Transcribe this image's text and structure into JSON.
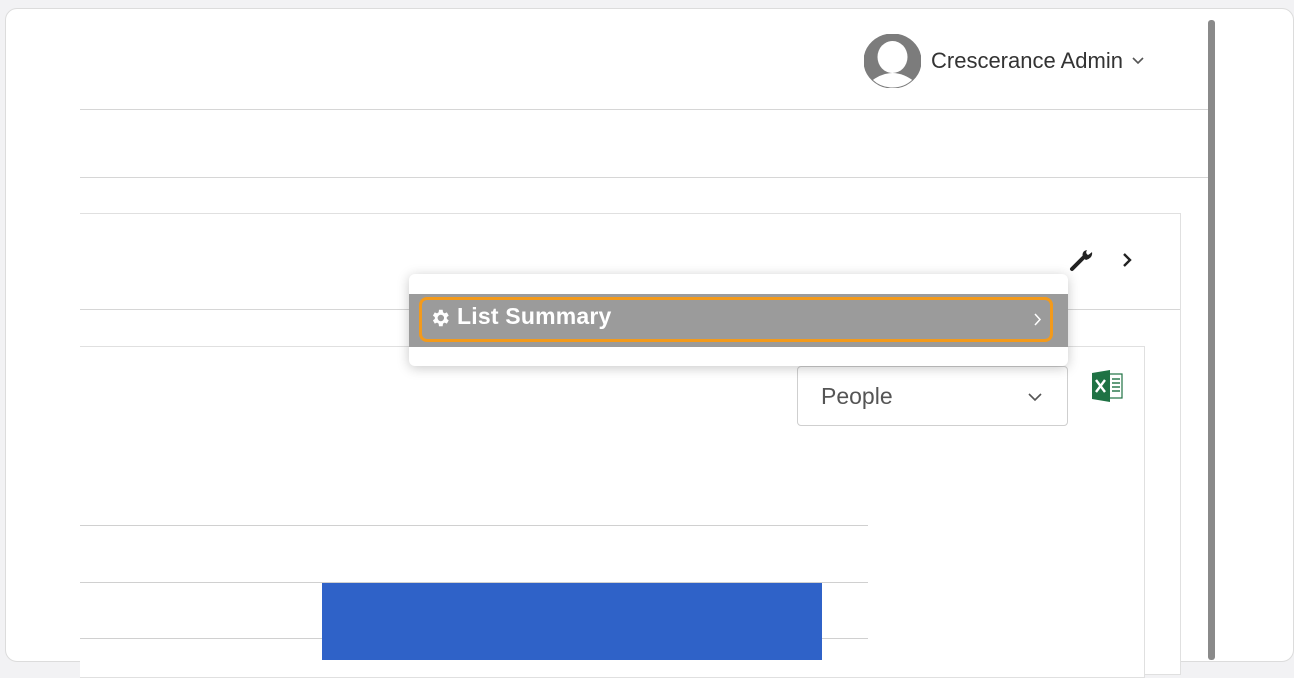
{
  "header": {
    "user_name": "Crescerance Admin",
    "user_icon": "user-avatar-icon",
    "menu_caret_icon": "chevron-down-icon"
  },
  "panel": {
    "tool_icon": "wrench-icon",
    "next_icon": "chevron-right-icon"
  },
  "context_menu": {
    "items": [
      {
        "label": "List Summary",
        "icon": "gear-icon",
        "submenu_icon": "chevron-right-icon"
      }
    ]
  },
  "filter": {
    "selected": "People",
    "caret_icon": "chevron-down-icon"
  },
  "export": {
    "icon": "excel-icon"
  },
  "colors": {
    "bar": "#2f62c8",
    "menu_item_bg": "#9b9b9b",
    "focus_outline": "#f39a1b",
    "excel_green": "#1f7244"
  }
}
